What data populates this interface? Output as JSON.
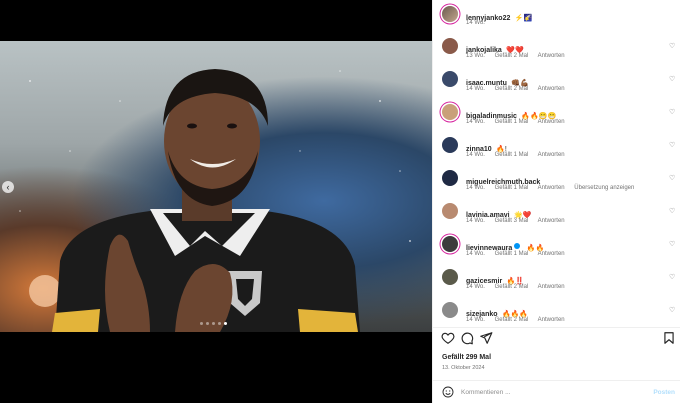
{
  "post": {
    "author": "lennyjanko22",
    "caption_emoji": "⚡🌠",
    "age": "14 Wo."
  },
  "carousel": {
    "prev_label": "‹",
    "slides": 5,
    "active_slide": 4
  },
  "labels": {
    "reply": "Antworten",
    "translate": "Übersetzung anzeigen"
  },
  "comments": [
    {
      "user": "jankojalika",
      "text": "❤️❤️",
      "age": "13 Wo.",
      "likes": "Gefällt 2 Mal",
      "avatar_color": "#8a5a4a"
    },
    {
      "user": "isaac.muntu",
      "text": "👊🏾💪🏾",
      "age": "14 Wo.",
      "likes": "Gefällt 2 Mal",
      "avatar_color": "#3a4a6a"
    },
    {
      "user": "bigaladinmusic",
      "text": "🔥🔥😁😁",
      "age": "14 Wo.",
      "likes": "Gefällt 1 Mal",
      "avatar_color": "#c9a07a",
      "ring": true
    },
    {
      "user": "zinna10",
      "text": "🔥!",
      "age": "14 Wo.",
      "likes": "Gefällt 1 Mal",
      "avatar_color": "#2a3a5a"
    },
    {
      "user": "miguelreichmuth.back",
      "text": "",
      "age": "14 Wo.",
      "likes": "Gefällt 1 Mal",
      "avatar_color": "#1f2a44",
      "translate": true
    },
    {
      "user": "lavinia.amavi",
      "text": "🌟❤️",
      "age": "14 Wo.",
      "likes": "Gefällt 3 Mal",
      "avatar_color": "#b88a70"
    },
    {
      "user": "lievinnewaura",
      "text": "🔥🔥",
      "age": "14 Wo.",
      "likes": "Gefällt 1 Mal",
      "avatar_color": "#3c3c3c",
      "ring": true,
      "verified": true
    },
    {
      "user": "gazicesmir",
      "text": "🔥‼️",
      "age": "14 Wo.",
      "likes": "Gefällt 2 Mal",
      "avatar_color": "#5a5a4a"
    },
    {
      "user": "sizejanko",
      "text": "🔥🔥🔥",
      "age": "14 Wo.",
      "likes": "Gefällt 2 Mal",
      "avatar_color": "#8a8a8a"
    }
  ],
  "stats": {
    "likes": "Gefällt 299 Mal",
    "date": "13. Oktober 2024"
  },
  "compose": {
    "placeholder": "Kommentieren ...",
    "post_label": "Posten"
  },
  "colors": {
    "accent_ring": "#d6249f",
    "verified": "#0095f6",
    "post_disabled": "#b2dffc"
  }
}
